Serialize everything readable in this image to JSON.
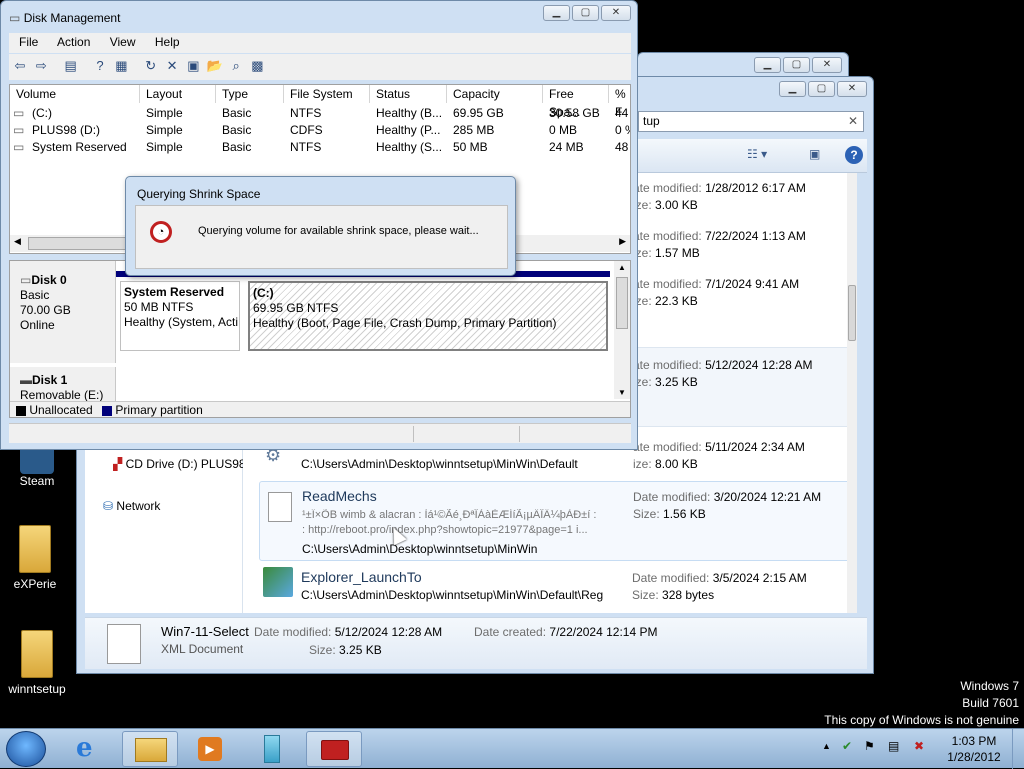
{
  "desktop": {
    "icons": [
      {
        "label": "Steam"
      },
      {
        "label": "eXPerie"
      },
      {
        "label": "winntsetup"
      }
    ],
    "watermark": [
      "Windows 7",
      "Build 7601",
      "This copy of Windows is not genuine"
    ]
  },
  "explorer_back": {},
  "explorer": {
    "search_value": "tup",
    "nav": {
      "cd_drive": "CD Drive (D:) PLUS98",
      "network": "Network"
    },
    "files": [
      {
        "date": "1/28/2012 6:17 AM",
        "size": "3.00 KB"
      },
      {
        "date": "7/22/2024 1:13 AM",
        "size": "1.57 MB"
      },
      {
        "date": "7/1/2024 9:41 AM",
        "size": "22.3 KB"
      },
      {
        "date": "5/12/2024 12:28 AM",
        "size": "3.25 KB"
      },
      {
        "date": "5/11/2024 2:34 AM",
        "size": "8.00 KB",
        "path": "C:\\Users\\Admin\\Desktop\\winntsetup\\MinWin\\Default"
      },
      {
        "name": "ReadMechs",
        "date": "3/20/2024 12:21 AM",
        "size": "1.56 KB",
        "snippet1": "¹±Ï×ÕB wimb & alacran : Ìá¹©Ãé¸ÐªÎÀàÈÆÍíÃ¡µÄÎÄ¼þÀÐ±í :",
        "snippet2": ": http://reboot.pro/index.php?showtopic=21977&page=1 i...",
        "path": "C:\\Users\\Admin\\Desktop\\winntsetup\\MinWin"
      },
      {
        "name": "Explorer_LaunchTo",
        "date": "3/5/2024 2:15 AM",
        "size": "328 bytes",
        "path": "C:\\Users\\Admin\\Desktop\\winntsetup\\MinWin\\Default\\Reg"
      }
    ],
    "labels": {
      "date_modified": "Date modified:",
      "size": "Size:",
      "date_created": "Date created:",
      "short_date": "ate modified:",
      "short_size": "ize:"
    },
    "details": {
      "name": "Win7-11-Select",
      "type": "XML Document",
      "date_modified": "5/12/2024 12:28 AM",
      "date_created": "7/22/2024 12:14 PM",
      "size": "3.25 KB"
    }
  },
  "disk_mgmt": {
    "title": "Disk Management",
    "menu": [
      "File",
      "Action",
      "View",
      "Help"
    ],
    "columns": [
      "Volume",
      "Layout",
      "Type",
      "File System",
      "Status",
      "Capacity",
      "Free Spa...",
      "% F"
    ],
    "volumes": [
      [
        "(C:)",
        "Simple",
        "Basic",
        "NTFS",
        "Healthy (B...",
        "69.95 GB",
        "30.58 GB",
        "44"
      ],
      [
        "PLUS98 (D:)",
        "Simple",
        "Basic",
        "CDFS",
        "Healthy (P...",
        "285 MB",
        "0 MB",
        "0 %"
      ],
      [
        "System Reserved",
        "Simple",
        "Basic",
        "NTFS",
        "Healthy (S...",
        "50 MB",
        "24 MB",
        "48"
      ]
    ],
    "disk0": {
      "name": "Disk 0",
      "type": "Basic",
      "size": "70.00 GB",
      "state": "Online"
    },
    "disk1": {
      "name": "Disk 1",
      "type": "Removable (E:)"
    },
    "partitions": [
      {
        "name": "System Reserved",
        "size": "50 MB NTFS",
        "status": "Healthy (System, Acti"
      },
      {
        "name": "(C:)",
        "size": "69.95 GB NTFS",
        "status": "Healthy (Boot, Page File, Crash Dump, Primary Partition)"
      }
    ],
    "legend": {
      "unallocated": "Unallocated",
      "primary": "Primary partition"
    }
  },
  "dialog": {
    "title": "Querying Shrink Space",
    "message": "Querying volume for available shrink space, please wait..."
  },
  "taskbar": {
    "time": "1:03 PM",
    "date": "1/28/2012"
  }
}
